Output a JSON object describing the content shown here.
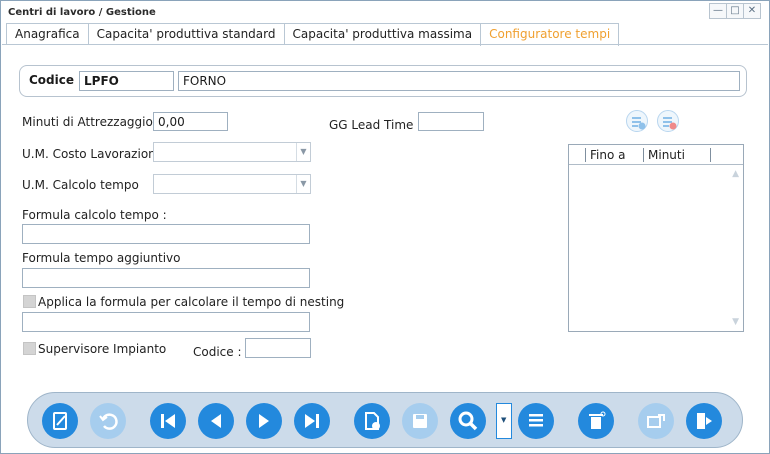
{
  "window": {
    "title": "Centri di lavoro / Gestione",
    "minimize_glyph": "—",
    "maximize_glyph": "□",
    "close_glyph": "✕"
  },
  "tabs": [
    {
      "label": "Anagrafica"
    },
    {
      "label": "Capacita' produttiva standard"
    },
    {
      "label": "Capacita' produttiva massima"
    },
    {
      "label": "Configuratore tempi",
      "active": true
    }
  ],
  "header": {
    "codice_label": "Codice :",
    "codice_value": "LPFO",
    "description_value": "FORNO"
  },
  "form": {
    "minuti_attrezzaggio_label": "Minuti di Attrezzaggio",
    "minuti_attrezzaggio_value": "0,00",
    "gg_lead_time_label": "GG Lead Time :",
    "gg_lead_time_value": "",
    "um_costo_label": "U.M. Costo Lavorazione",
    "um_costo_value": "",
    "um_calcolo_label": "U.M. Calcolo tempo",
    "um_calcolo_value": "",
    "formula_calcolo_label": "Formula calcolo tempo :",
    "formula_calcolo_value": "",
    "formula_aggiuntivo_label": "Formula tempo aggiuntivo",
    "formula_aggiuntivo_value": "",
    "applica_nesting_label": "Applica la formula per calcolare il tempo di nesting",
    "applica_nesting_checked": false,
    "nesting_value": "",
    "supervisore_label": "Supervisore Impianto",
    "supervisore_checked": false,
    "supervisore_codice_label": "Codice :",
    "supervisore_codice_value": ""
  },
  "grid": {
    "columns": [
      "Fino a",
      "Minuti"
    ],
    "rows": []
  },
  "colors": {
    "accent": "#2389dd",
    "accent_disabled": "#a6cdee",
    "active_tab": "#f0a030",
    "toolbar_bg": "#ccdbea"
  },
  "toolbar": {
    "buttons": [
      {
        "icon": "edit-document-icon",
        "enabled": true
      },
      {
        "icon": "undo-icon",
        "enabled": false
      },
      {
        "icon": "first-record-icon",
        "enabled": true
      },
      {
        "icon": "previous-record-icon",
        "enabled": true
      },
      {
        "icon": "next-record-icon",
        "enabled": true
      },
      {
        "icon": "last-record-icon",
        "enabled": true
      },
      {
        "icon": "new-document-icon",
        "enabled": true
      },
      {
        "icon": "save-icon",
        "enabled": false
      },
      {
        "icon": "search-icon",
        "enabled": true
      },
      {
        "icon": "list-icon",
        "enabled": true
      },
      {
        "icon": "delete-icon",
        "enabled": true
      },
      {
        "icon": "transfer-icon",
        "enabled": false
      },
      {
        "icon": "exit-icon",
        "enabled": true
      }
    ]
  }
}
